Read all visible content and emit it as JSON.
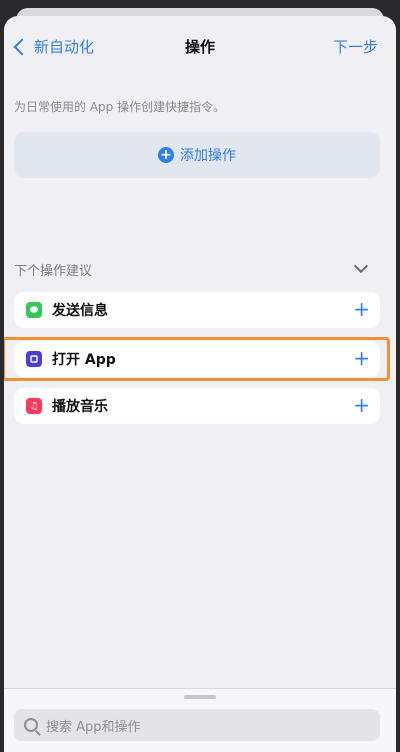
{
  "nav": {
    "back_label": "新自动化",
    "title": "操作",
    "next_label": "下一步"
  },
  "hint": "为日常使用的 App 操作创建快捷指令。",
  "add_action": {
    "label": "添加操作",
    "icon": "plus-circle-icon"
  },
  "suggestions": {
    "header": "下个操作建议",
    "items": [
      {
        "label": "发送信息",
        "icon": "messages-icon",
        "color": "#34c759"
      },
      {
        "label": "打开 App",
        "icon": "open-app-icon",
        "color": "#4b3fd1"
      },
      {
        "label": "播放音乐",
        "icon": "music-icon",
        "color": "#ff3b5c"
      }
    ]
  },
  "search": {
    "placeholder": "搜索 App和操作"
  },
  "colors": {
    "accent": "#2f7fe8",
    "highlight": "#f0913a"
  }
}
